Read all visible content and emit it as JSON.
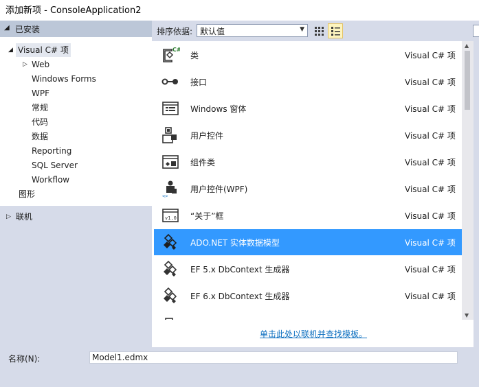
{
  "window": {
    "title": "添加新项 - ConsoleApplication2"
  },
  "sidebar": {
    "installed_label": "已安装",
    "tree": [
      {
        "label": "Visual C# 项",
        "level": 0,
        "expanded": true,
        "selected": true
      },
      {
        "label": "Web",
        "level": 1,
        "collapsible": true
      },
      {
        "label": "Windows Forms",
        "level": 1
      },
      {
        "label": "WPF",
        "level": 1
      },
      {
        "label": "常规",
        "level": 1
      },
      {
        "label": "代码",
        "level": 1
      },
      {
        "label": "数据",
        "level": 1
      },
      {
        "label": "Reporting",
        "level": 1
      },
      {
        "label": "SQL Server",
        "level": 1
      },
      {
        "label": "Workflow",
        "level": 1
      },
      {
        "label": "图形",
        "level": 0
      }
    ],
    "online_label": "联机"
  },
  "toolbar": {
    "sort_label": "排序依据:",
    "sort_value": "默认值",
    "view_small_icons": "grid-view-icon",
    "view_list": "list-view-icon"
  },
  "templates": [
    {
      "name": "类",
      "type": "Visual C# 项",
      "icon": "class-icon",
      "selected": false
    },
    {
      "name": "接口",
      "type": "Visual C# 项",
      "icon": "interface-icon",
      "selected": false
    },
    {
      "name": "Windows 窗体",
      "type": "Visual C# 项",
      "icon": "windows-form-icon",
      "selected": false
    },
    {
      "name": "用户控件",
      "type": "Visual C# 项",
      "icon": "user-control-icon",
      "selected": false
    },
    {
      "name": "组件类",
      "type": "Visual C# 项",
      "icon": "component-class-icon",
      "selected": false
    },
    {
      "name": "用户控件(WPF)",
      "type": "Visual C# 项",
      "icon": "wpf-user-control-icon",
      "selected": false
    },
    {
      "name": "“关于”框",
      "type": "Visual C# 项",
      "icon": "about-box-icon",
      "selected": false
    },
    {
      "name": "ADO.NET 实体数据模型",
      "type": "Visual C# 项",
      "icon": "entity-model-icon",
      "selected": true
    },
    {
      "name": "EF 5.x DbContext 生成器",
      "type": "Visual C# 项",
      "icon": "dbcontext-generator-icon",
      "selected": false
    },
    {
      "name": "EF 6.x DbContext 生成器",
      "type": "Visual C# 项",
      "icon": "dbcontext-generator-icon",
      "selected": false
    }
  ],
  "online_search_link": "单击此处以联机并查找模板。",
  "name_field": {
    "label": "名称(N):",
    "value": "Model1.edmx"
  },
  "colors": {
    "selection": "#3399ff",
    "link": "#0e70c0",
    "panel_bg": "#d6dbe9"
  }
}
